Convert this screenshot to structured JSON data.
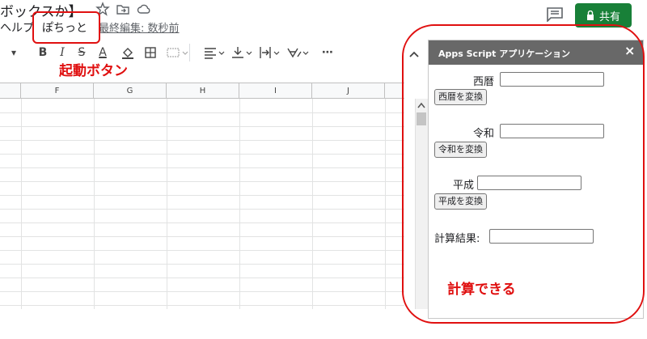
{
  "header": {
    "doc_title": "ボックスか】",
    "menu": {
      "help": "ヘルプ",
      "pochitto": "ぽちっと",
      "last_edit": "最終編集: 数秒前"
    },
    "share_label": "共有"
  },
  "toolbar": {
    "collapse_arrow": "▾",
    "bold": "B",
    "italic": "I",
    "strike": "S",
    "text_color": "A",
    "more": "⋯"
  },
  "grid": {
    "columns": [
      "F",
      "G",
      "H",
      "I",
      "J"
    ]
  },
  "sidebar": {
    "title": "Apps Script アプリケーション",
    "close": "×",
    "seireki_label": "西暦",
    "seireki_button": "西暦を変換",
    "reiwa_label": "令和",
    "reiwa_button": "令和を変換",
    "heisei_label": "平成",
    "heisei_button": "平成を変換",
    "result_label": "計算結果:"
  },
  "annotations": {
    "launch_button": "起動ボタン",
    "can_calculate": "計算できる"
  },
  "colors": {
    "share_green": "#188038",
    "annotation_red": "#e01010",
    "sidebar_header": "#686868"
  }
}
